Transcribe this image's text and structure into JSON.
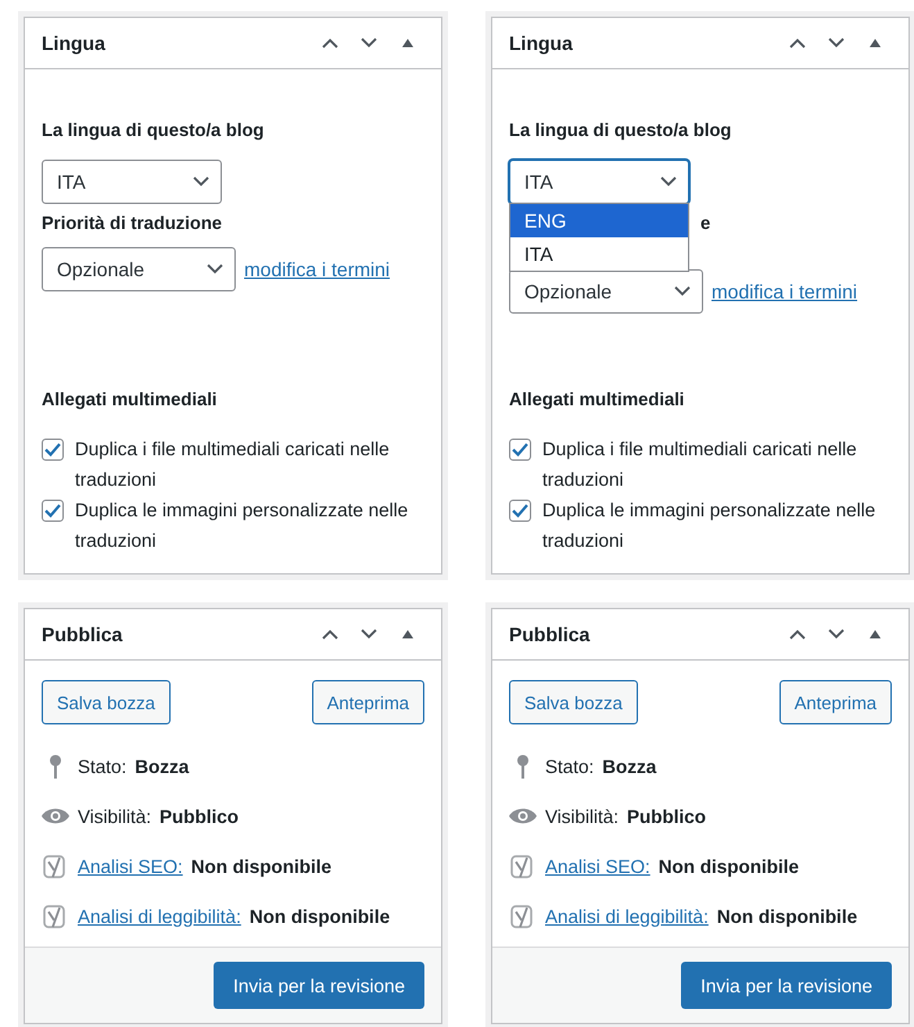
{
  "columns": [
    {
      "language_box": {
        "title": "Lingua",
        "blog_language_label": "La lingua di questo/a blog",
        "language_select": {
          "value": "ITA",
          "open": false
        },
        "priority_label": "Priorità di traduzione",
        "priority_select": {
          "value": "Opzionale"
        },
        "terms_link": "modifica i termini",
        "media_title": "Allegati multimediali",
        "checkboxes": [
          {
            "label": "Duplica i file multimediali caricati nelle traduzioni",
            "checked": true
          },
          {
            "label": "Duplica le immagini personalizzate nelle traduzioni",
            "checked": true
          }
        ]
      },
      "publish_box": {
        "title": "Pubblica",
        "save_button": "Salva bozza",
        "preview_button": "Anteprima",
        "rows": [
          {
            "kind": "status",
            "label": "Stato:",
            "value": "Bozza"
          },
          {
            "kind": "visibility",
            "label": "Visibilità:",
            "value": "Pubblico"
          },
          {
            "kind": "analysis",
            "link": "Analisi SEO:",
            "value": "Non disponibile"
          },
          {
            "kind": "analysis",
            "link": "Analisi di leggibilità:",
            "value": "Non disponibile"
          }
        ],
        "submit_button": "Invia per la revisione"
      }
    },
    {
      "language_box": {
        "title": "Lingua",
        "blog_language_label": "La lingua di questo/a blog",
        "language_select": {
          "value": "ITA",
          "open": true,
          "options": [
            {
              "label": "ENG",
              "highlighted": true
            },
            {
              "label": "ITA",
              "highlighted": false
            }
          ]
        },
        "priority_label": "e",
        "priority_select": {
          "value": "Opzionale"
        },
        "terms_link": "modifica i termini",
        "media_title": "Allegati multimediali",
        "checkboxes": [
          {
            "label": "Duplica i file multimediali caricati nelle traduzioni",
            "checked": true
          },
          {
            "label": "Duplica le immagini personalizzate nelle traduzioni",
            "checked": true
          }
        ]
      },
      "publish_box": {
        "title": "Pubblica",
        "save_button": "Salva bozza",
        "preview_button": "Anteprima",
        "rows": [
          {
            "kind": "status",
            "label": "Stato:",
            "value": "Bozza"
          },
          {
            "kind": "visibility",
            "label": "Visibilità:",
            "value": "Pubblico"
          },
          {
            "kind": "analysis",
            "link": "Analisi SEO:",
            "value": "Non disponibile"
          },
          {
            "kind": "analysis",
            "link": "Analisi di leggibilità:",
            "value": "Non disponibile"
          }
        ],
        "submit_button": "Invia per la revisione"
      }
    }
  ]
}
